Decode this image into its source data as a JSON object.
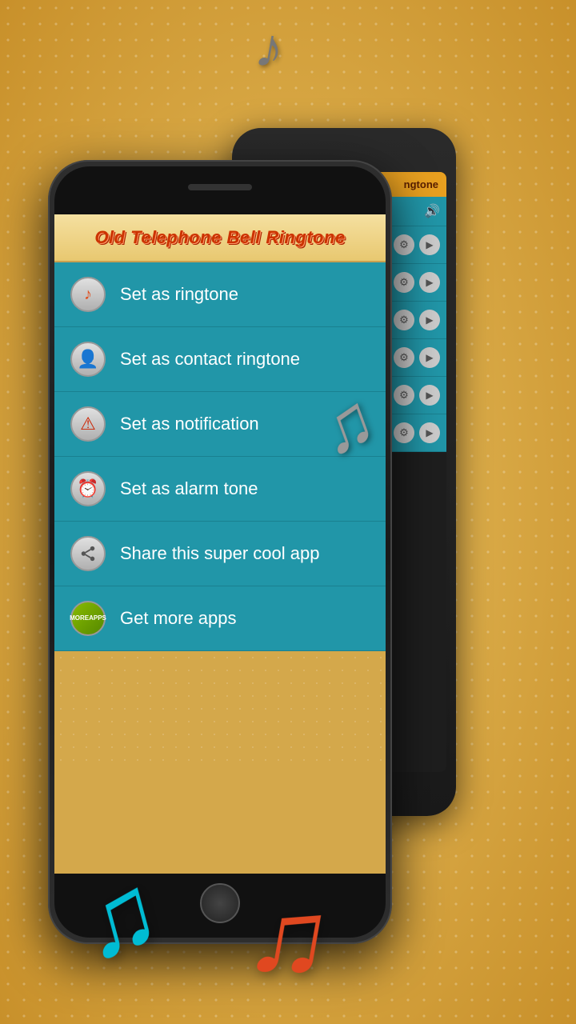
{
  "background": {
    "color": "#d4a84b"
  },
  "app": {
    "title": "Old Telephone Bell Ringtone",
    "menu_items": [
      {
        "id": "ringtone",
        "label": "Set as ringtone",
        "icon": "♪",
        "icon_color": "#e05020"
      },
      {
        "id": "contact_ringtone",
        "label": "Set as contact ringtone",
        "icon": "👤",
        "icon_color": "#888"
      },
      {
        "id": "notification",
        "label": "Set as notification",
        "icon": "⚠",
        "icon_color": "#cc2200"
      },
      {
        "id": "alarm",
        "label": "Set as alarm tone",
        "icon": "⏰",
        "icon_color": "#888"
      },
      {
        "id": "share",
        "label": "Share this super cool app",
        "icon": "⟨",
        "icon_color": "#555"
      },
      {
        "id": "more_apps",
        "label": "Get more apps",
        "icon": "▦",
        "icon_color": "#66aa00"
      }
    ]
  },
  "back_phone": {
    "header_text": "ngtone",
    "rows": [
      {
        "gear": "⚙",
        "play": "▶"
      },
      {
        "gear": "⚙",
        "play": "▶"
      },
      {
        "gear": "⚙",
        "play": "▶"
      },
      {
        "gear": "⚙",
        "play": "▶"
      },
      {
        "gear": "⚙",
        "play": "▶"
      },
      {
        "gear": "⚙",
        "play": "▶"
      }
    ]
  },
  "icons": {
    "music_note": "♫",
    "speaker": "🔊"
  }
}
